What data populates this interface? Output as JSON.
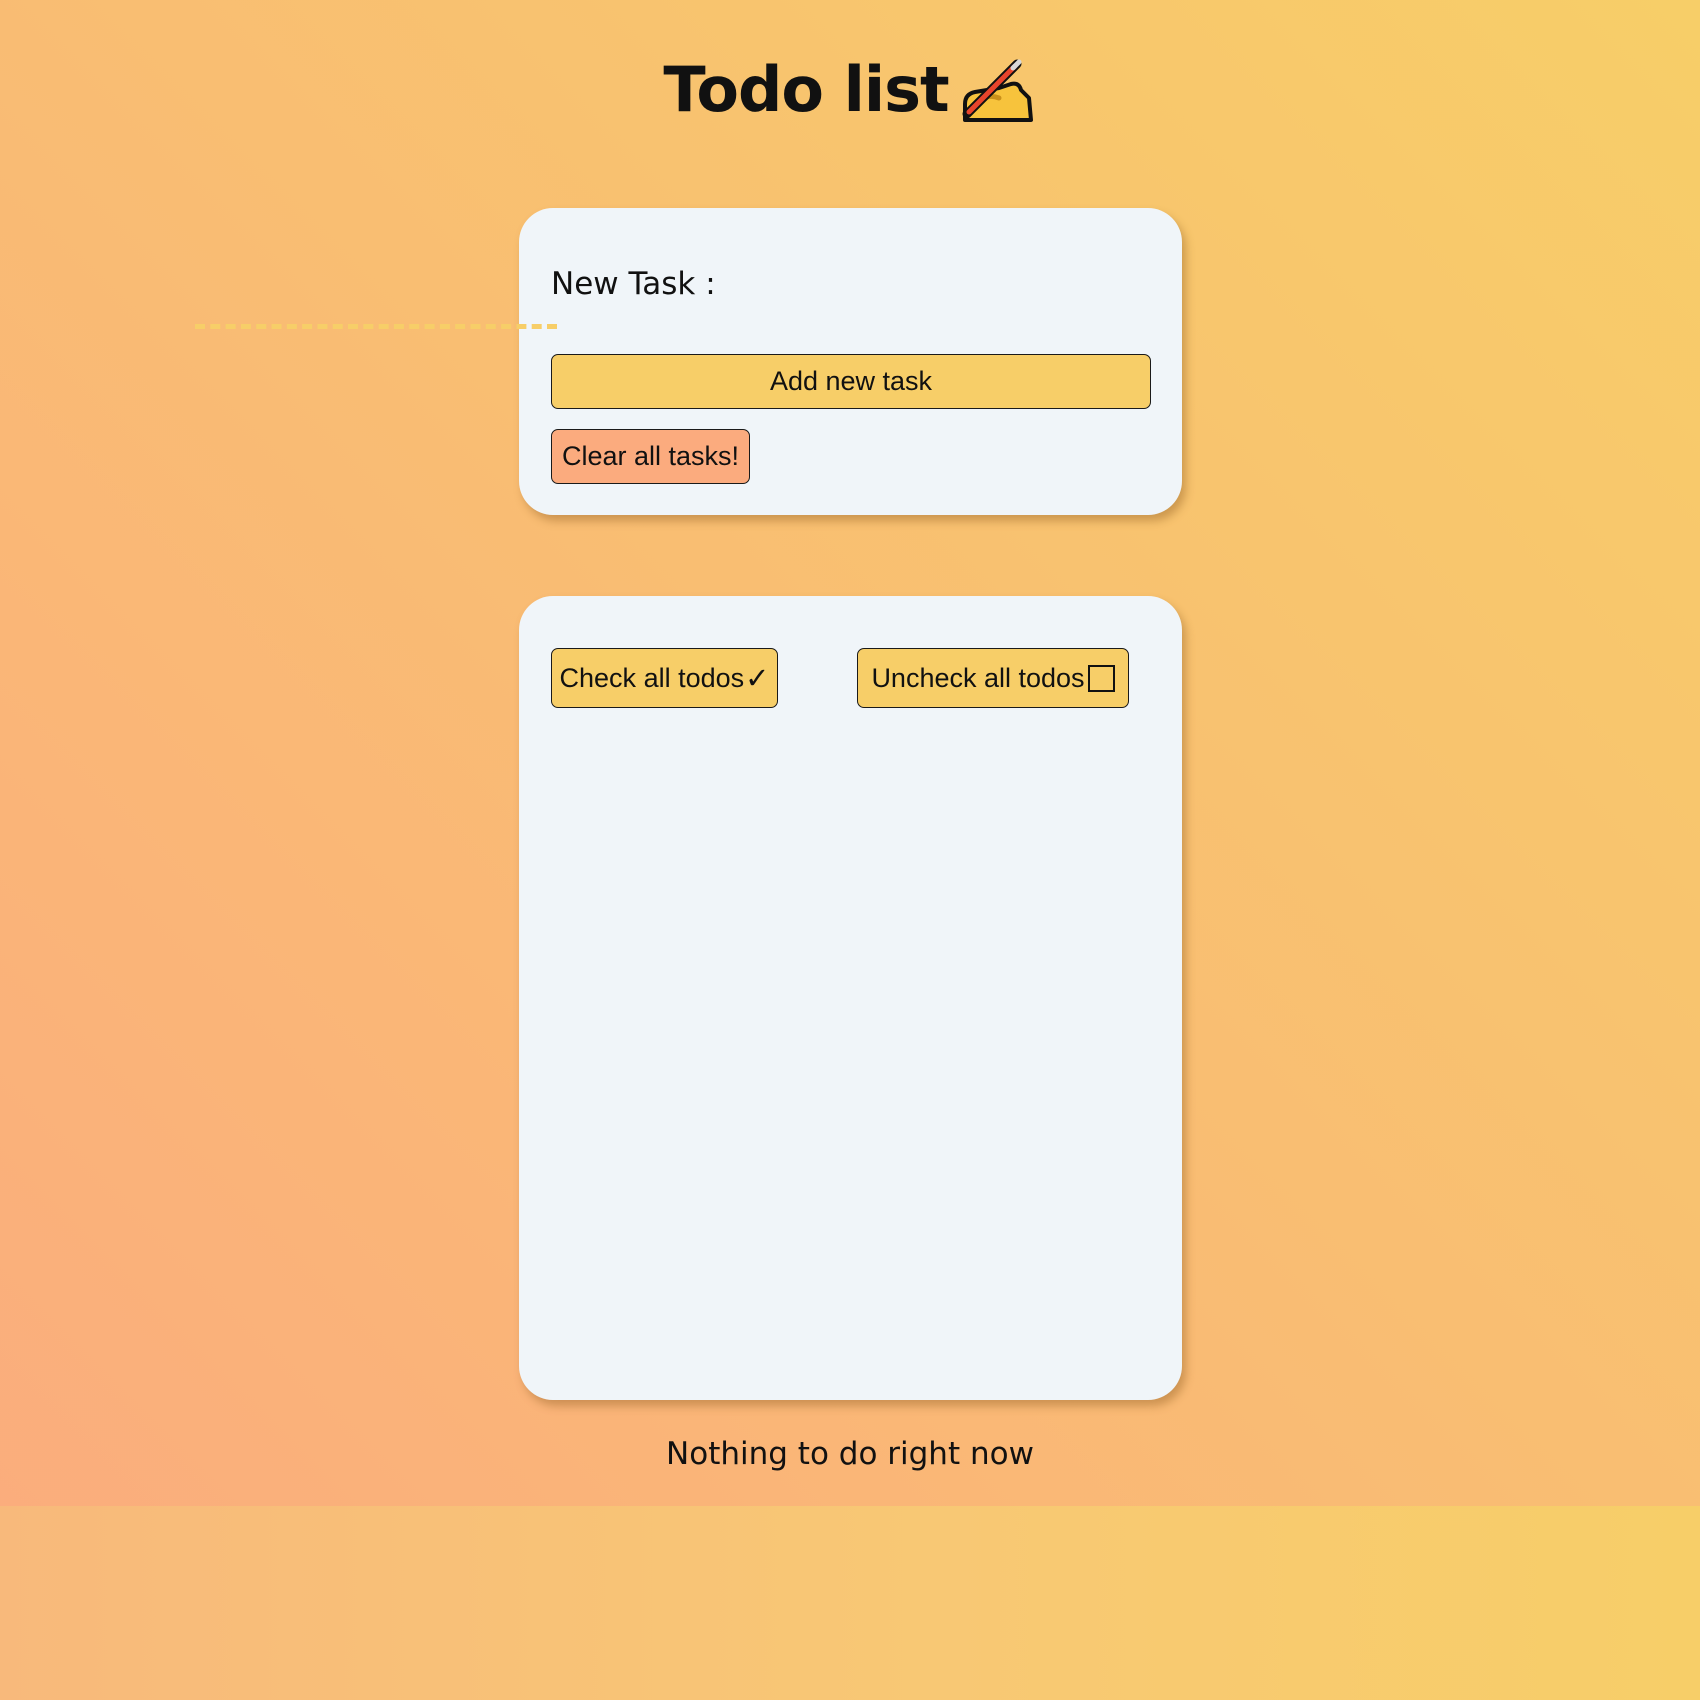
{
  "header": {
    "title": "Todo list",
    "title_icon": "writing-hand-icon"
  },
  "new_task_form": {
    "label": "New Task :",
    "input_value": "",
    "input_placeholder": "",
    "add_button_label": "Add new task",
    "clear_button_label": "Clear all tasks!"
  },
  "todo_list": {
    "check_all_label": "Check all todos",
    "check_all_icon": "check-mark-icon",
    "check_all_glyph": "✓",
    "uncheck_all_label": "Uncheck all todos",
    "uncheck_all_icon": "empty-checkbox-icon",
    "items": []
  },
  "footer": {
    "empty_message": "Nothing to do right now"
  },
  "colors": {
    "gradient_start": "#fbab7e",
    "gradient_end": "#f7ce68",
    "card_background": "#f0f5f9",
    "primary_button": "#f7ce68",
    "danger_button": "#fbab7e"
  }
}
